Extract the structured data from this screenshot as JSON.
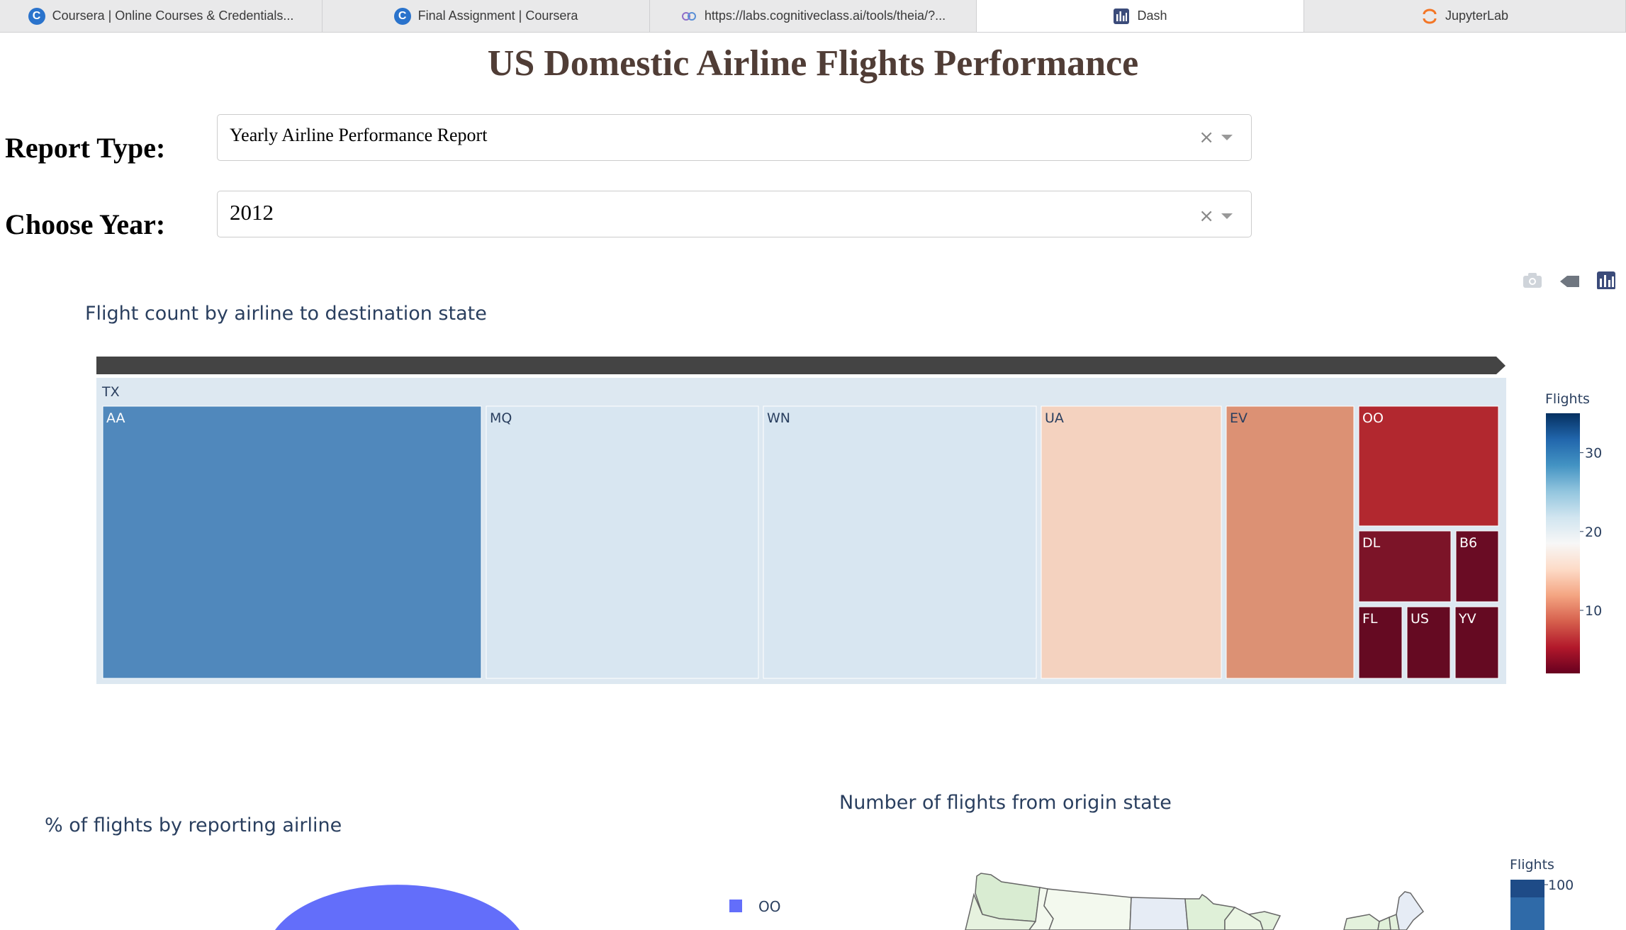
{
  "browser": {
    "tabs": [
      {
        "title": "Coursera | Online Courses & Credentials...",
        "icon": "coursera-icon",
        "active": false
      },
      {
        "title": "Final Assignment | Coursera",
        "icon": "coursera-icon",
        "active": false
      },
      {
        "title": "https://labs.cognitiveclass.ai/tools/theia/?...",
        "icon": "theia-icon",
        "active": false
      },
      {
        "title": "Dash",
        "icon": "dash-icon",
        "active": true
      },
      {
        "title": "JupyterLab",
        "icon": "jupyter-icon",
        "active": false
      }
    ]
  },
  "page": {
    "title": "US Domestic Airline Flights Performance"
  },
  "controls": {
    "report_type": {
      "label": "Report Type:",
      "value": "Yearly Airline Performance Report",
      "clear": "×"
    },
    "year": {
      "label": "Choose Year:",
      "value": "2012",
      "clear": "×"
    }
  },
  "modebar": {
    "icons": [
      "camera-icon",
      "tag-icon",
      "plotly-logo-icon"
    ]
  },
  "treemap": {
    "title": "Flight count by airline to destination state",
    "root_label": "TX",
    "colorbar": {
      "title": "Flights",
      "ticks": [
        10,
        20,
        30
      ],
      "range": [
        2,
        35
      ],
      "colors": [
        "#67001f",
        "#b2182b",
        "#d6604d",
        "#f4a582",
        "#fddbc7",
        "#f7f7f7",
        "#d1e5f0",
        "#92c5de",
        "#4393c3",
        "#2166ac",
        "#053061"
      ]
    },
    "colors": {
      "AA": "#5088bc",
      "MQ": "#d8e6f1",
      "WN": "#d8e6f1",
      "UA": "#f4d2bf",
      "EV": "#dc9174",
      "OO": "#b2282f",
      "DL": "#7c1428",
      "B6": "#6a0c24",
      "FL": "#650a22",
      "US": "#650a22",
      "YV": "#650a22"
    },
    "text_colors": {
      "dark": "#2a3f5f",
      "light": "#ffffff"
    }
  },
  "chart_data": [
    {
      "type": "treemap",
      "title": "Flight count by airline to destination state",
      "root": "TX",
      "labels": [
        "AA",
        "MQ",
        "WN",
        "UA",
        "EV",
        "OO",
        "DL",
        "B6",
        "FL",
        "US",
        "YV"
      ],
      "values": [
        30,
        22,
        22,
        14,
        11,
        7,
        4,
        2,
        2,
        2,
        2
      ],
      "colorbar_title": "Flights",
      "colorbar_ticks": [
        10,
        20,
        30
      ]
    },
    {
      "type": "pie",
      "title": "% of flights by reporting airline",
      "legend": [
        "OO"
      ],
      "series_colors": [
        "#636efa"
      ]
    },
    {
      "type": "choropleth",
      "title": "Number of flights from origin state",
      "colorbar_title": "Flights",
      "colorbar_ticks": [
        100
      ]
    }
  ],
  "pie": {
    "title": "% of flights by reporting airline",
    "legend_item": "OO",
    "slice_color": "#636efa"
  },
  "map": {
    "title": "Number of flights from origin state",
    "colorbar_title": "Flights",
    "colorbar_tick": "100"
  }
}
